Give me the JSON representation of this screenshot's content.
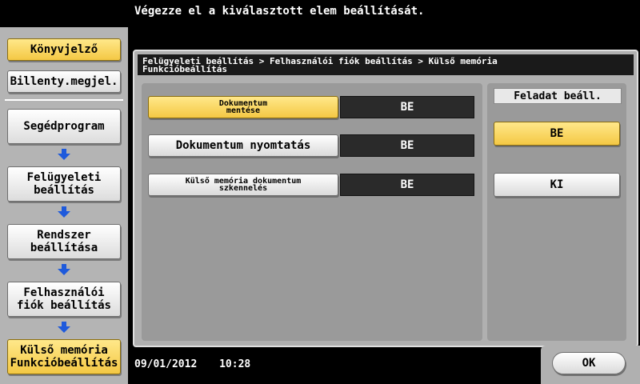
{
  "message": "Végezze el a kiválasztott elem beállítását.",
  "sidebar": {
    "top_buttons": [
      {
        "label": "Könyvjelző",
        "active": true
      },
      {
        "label": "Billenty.megjel.",
        "active": false
      }
    ],
    "path": [
      {
        "label": "Segédprogram"
      },
      {
        "label": "Felügyeleti\nbeállítás"
      },
      {
        "label": "Rendszer\nbeállítása"
      },
      {
        "label": "Felhasználói\nfiók beállítás"
      },
      {
        "label": "Külső memória\nFunkcióbeállítás"
      }
    ]
  },
  "breadcrumb": {
    "line1": "Felügyeleti beállítás > Felhasználói fiók beállítás > Külső memória",
    "line2": "Funkcióbeállítás"
  },
  "functions": [
    {
      "label": "Dokumentum\nmentése",
      "value": "BE"
    },
    {
      "label": "Dokumentum nyomtatás",
      "value": "BE"
    },
    {
      "label": "Külső memória dokumentum\nszkennelés",
      "value": "BE"
    }
  ],
  "task_setting": {
    "label": "Feladat beáll.",
    "on_label": "BE",
    "off_label": "KI"
  },
  "status": {
    "date": "09/01/2012",
    "time": "10:28"
  },
  "ok_label": "OK",
  "colors": {
    "accent": "#f4c844",
    "arrow": "#1e5adc"
  }
}
